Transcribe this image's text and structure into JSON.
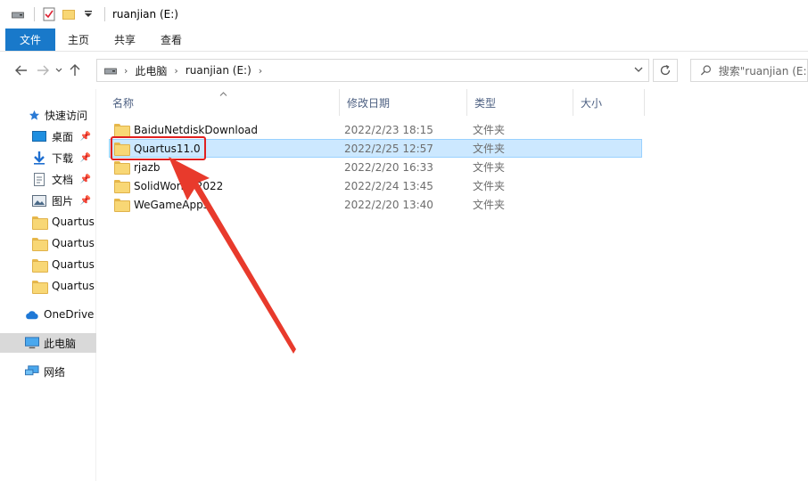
{
  "window": {
    "title": "ruanjian (E:)"
  },
  "ribbon": {
    "tabs": [
      "文件",
      "主页",
      "共享",
      "查看"
    ]
  },
  "address": {
    "segments": [
      "此电脑",
      "ruanjian (E:)"
    ],
    "search_placeholder": "搜索\"ruanjian (E:)\""
  },
  "columns": {
    "name": "名称",
    "date": "修改日期",
    "type": "类型",
    "size": "大小"
  },
  "nav": {
    "items": [
      {
        "label": "快速访问",
        "icon": "star-icon"
      },
      {
        "label": "桌面",
        "icon": "desktop-icon"
      },
      {
        "label": "下载",
        "icon": "download-icon"
      },
      {
        "label": "文档",
        "icon": "document-icon"
      },
      {
        "label": "图片",
        "icon": "picture-icon"
      },
      {
        "label": "Quartus",
        "icon": "folder-icon"
      },
      {
        "label": "Quartus",
        "icon": "folder-icon"
      },
      {
        "label": "Quartus",
        "icon": "folder-icon"
      },
      {
        "label": "Quartus",
        "icon": "folder-icon"
      },
      {
        "label": "OneDrive",
        "icon": "cloud-icon"
      },
      {
        "label": "此电脑",
        "icon": "computer-icon"
      },
      {
        "label": "网络",
        "icon": "network-icon"
      }
    ]
  },
  "files": [
    {
      "name": "BaiduNetdiskDownload",
      "date": "2022/2/23 18:15",
      "type": "文件夹"
    },
    {
      "name": "Quartus11.0",
      "date": "2022/2/25 12:57",
      "type": "文件夹"
    },
    {
      "name": "rjazb",
      "date": "2022/2/20 16:33",
      "type": "文件夹"
    },
    {
      "name": "SolidWorks 2022",
      "date": "2022/2/24 13:45",
      "type": "文件夹"
    },
    {
      "name": "WeGameApps",
      "date": "2022/2/20 13:40",
      "type": "文件夹"
    }
  ],
  "colors": {
    "accent": "#1979ca",
    "selection": "#cce8ff",
    "annotation": "#e02020"
  }
}
